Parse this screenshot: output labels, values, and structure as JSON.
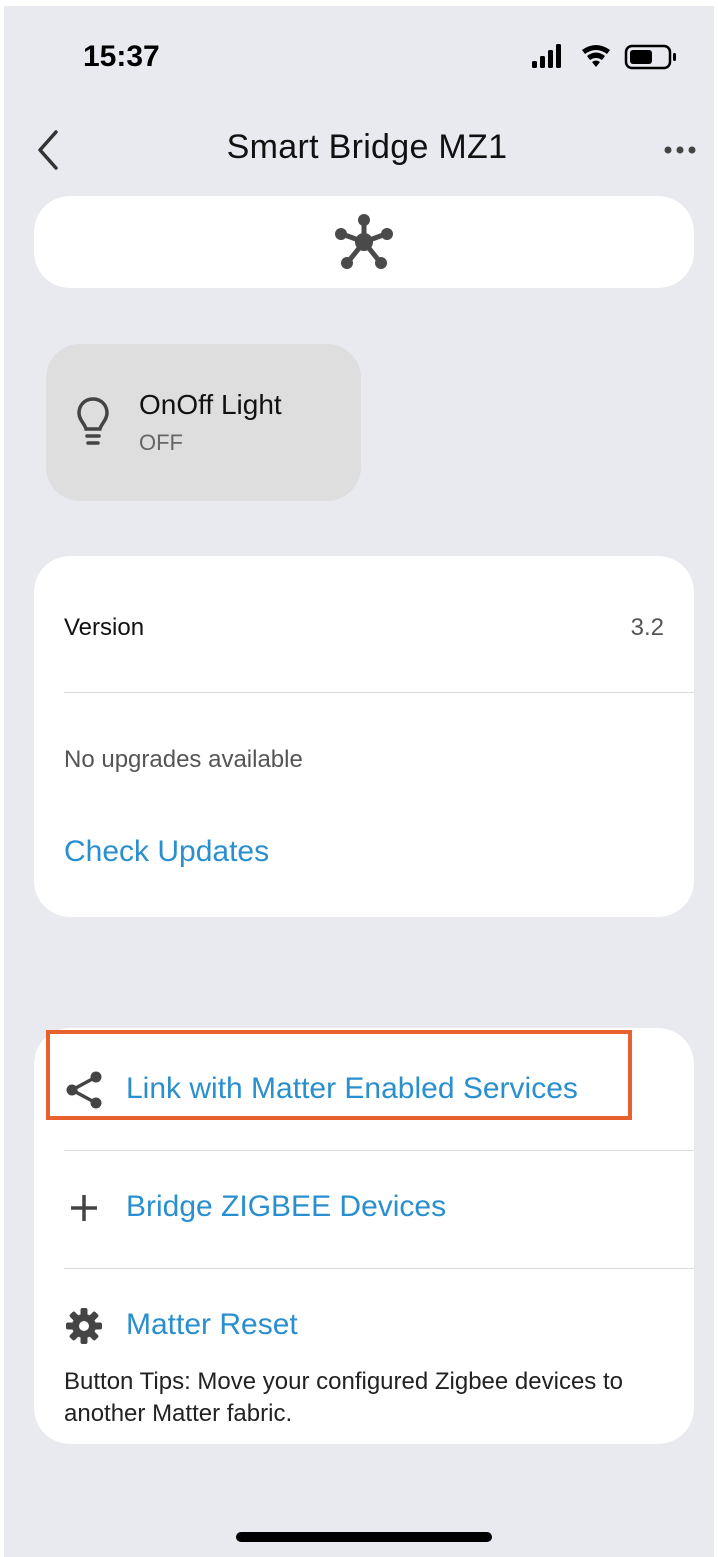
{
  "status_bar": {
    "time": "15:37"
  },
  "nav": {
    "title": "Smart Bridge MZ1",
    "back_icon": "chevron-left-icon",
    "more_icon": "ellipsis-icon"
  },
  "hub": {
    "icon": "hub-network-icon"
  },
  "device": {
    "name": "OnOff Light",
    "state": "OFF",
    "icon": "lightbulb-icon"
  },
  "firmware": {
    "version_label": "Version",
    "version_value": "3.2",
    "status_text": "No upgrades available",
    "check_label": "Check Updates"
  },
  "actions": {
    "items": [
      {
        "label": "Link with Matter Enabled Services",
        "icon": "share-icon"
      },
      {
        "label": "Bridge ZIGBEE Devices",
        "icon": "plus-icon"
      },
      {
        "label": "Matter Reset",
        "icon": "gear-icon"
      }
    ],
    "tips": "Button Tips: Move your configured Zigbee devices to another Matter fabric."
  },
  "colors": {
    "accent": "#2a8fce",
    "highlight": "#e8602e",
    "background": "#e9e9f0"
  }
}
